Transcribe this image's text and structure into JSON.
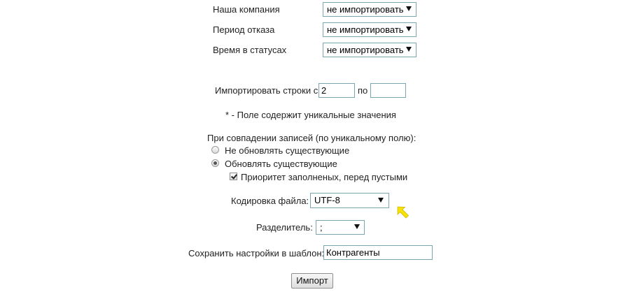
{
  "mapping_rows": [
    {
      "label": "Наша компания",
      "value": "не импортировать"
    },
    {
      "label": "Период отказа",
      "value": "не импортировать"
    },
    {
      "label": "Время в статусах",
      "value": "не импортировать"
    }
  ],
  "import_rows": {
    "label": "Импортировать строки с",
    "from_value": "2",
    "to_label": "по",
    "to_value": ""
  },
  "unique_note": "* - Поле содержит уникальные значения",
  "match_section": {
    "title": "При совпадении записей (по уникальному полю):",
    "option_no_update": "Не обновлять существующие",
    "option_update": "Обновлять существующие",
    "selected": "update",
    "priority_label": "Приоритет заполненых, перед пустыми",
    "priority_checked": true
  },
  "encoding": {
    "label": "Кодировка файла:",
    "value": "UTF-8"
  },
  "separator": {
    "label": "Разделитель:",
    "value": ";"
  },
  "template": {
    "label": "Сохранить настройки в шаблон:",
    "value": "Контрагенты"
  },
  "import_button": "Импорт",
  "colors": {
    "field_border": "#7aa6b0",
    "annotation_arrow": "#f5e20a"
  },
  "icons": {
    "annotation": "yellow-arrow-icon"
  }
}
